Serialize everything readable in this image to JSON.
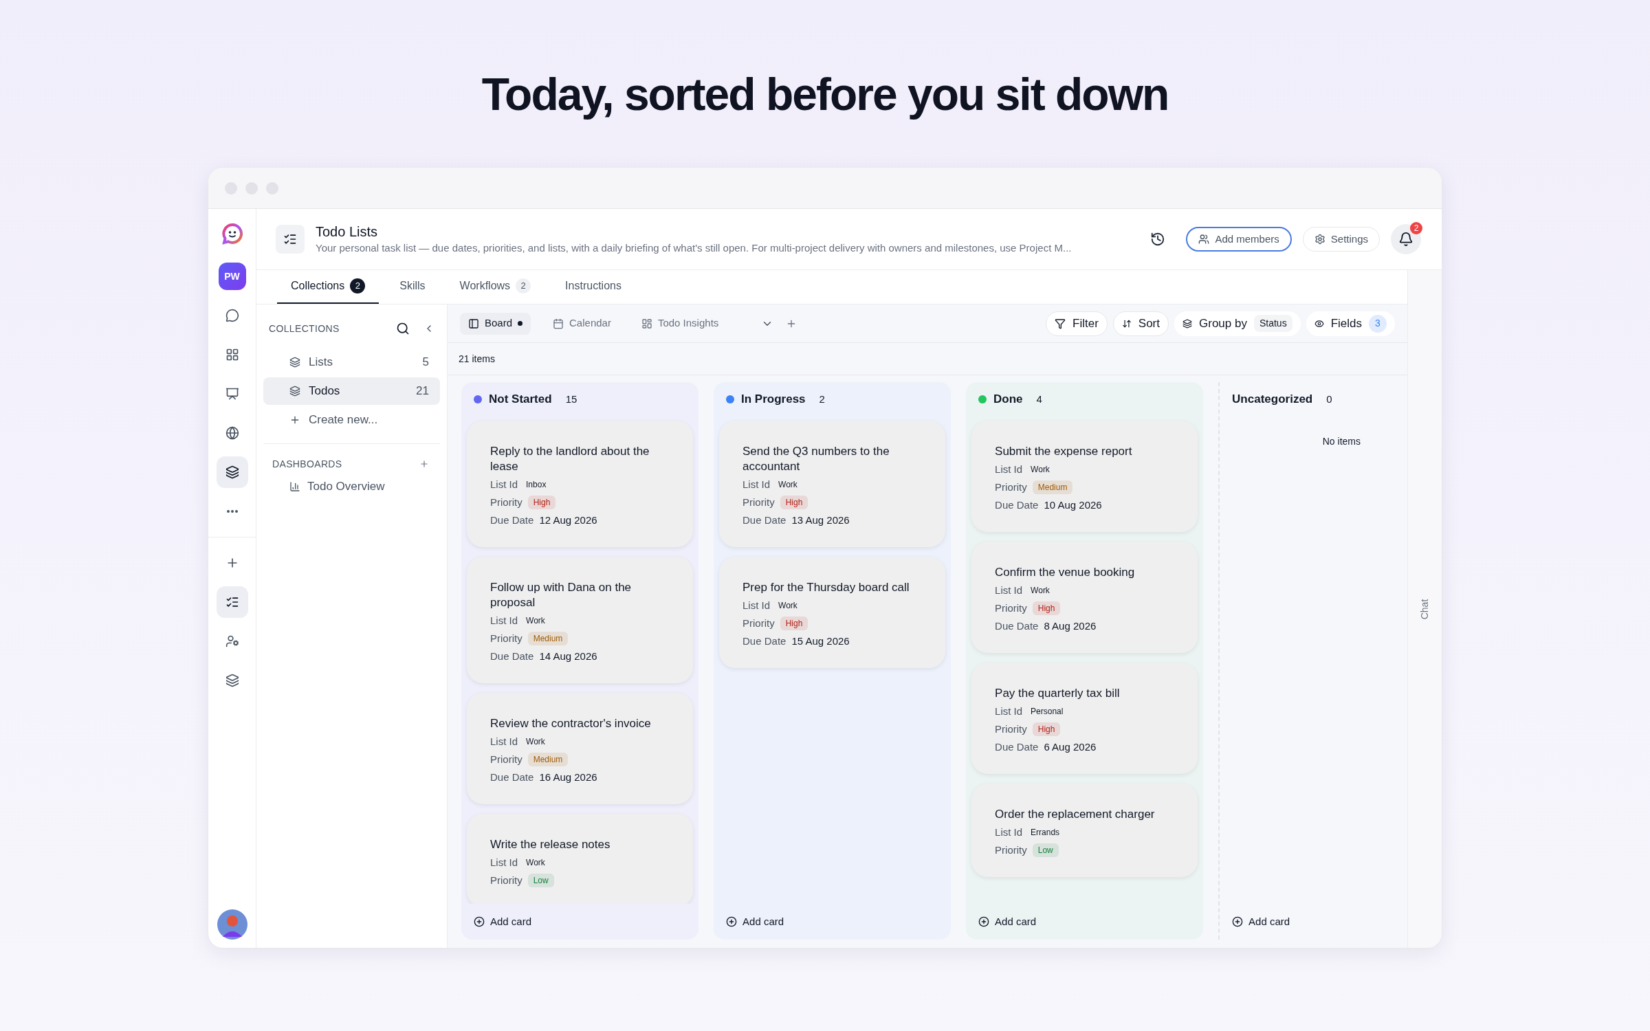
{
  "headline": "Today, sorted before you sit down",
  "rail": {
    "avatar": "PW",
    "items": [
      {
        "kind": "chat",
        "selected": false
      },
      {
        "kind": "grid",
        "selected": false
      },
      {
        "kind": "app",
        "selected": false
      },
      {
        "kind": "globe",
        "selected": false
      },
      {
        "kind": "layers",
        "selected": true
      },
      {
        "kind": "more",
        "selected": false
      }
    ],
    "apps": [
      {
        "kind": "plus",
        "selected": false
      },
      {
        "kind": "todo",
        "selected": true
      },
      {
        "kind": "person",
        "selected": false
      },
      {
        "kind": "layers",
        "selected": false
      }
    ]
  },
  "header": {
    "title": "Todo Lists",
    "description": "Your personal task list — due dates, priorities, and lists, with a daily briefing of what's still open. For multi-project delivery with owners and milestones, use Project M...",
    "add_members": "Add members",
    "settings": "Settings",
    "notifications": "2"
  },
  "tabs": [
    {
      "label": "Collections",
      "count": "2",
      "selected": true
    },
    {
      "label": "Skills",
      "selected": false
    },
    {
      "label": "Workflows",
      "count": "2",
      "selected": false
    },
    {
      "label": "Instructions",
      "selected": false
    }
  ],
  "sidebar": {
    "collections_heading": "COLLECTIONS",
    "collections": [
      {
        "label": "Lists",
        "count": "5",
        "selected": false
      },
      {
        "label": "Todos",
        "count": "21",
        "selected": true
      }
    ],
    "create_new": "Create new...",
    "dashboards_heading": "DASHBOARDS",
    "dashboards": [
      {
        "label": "Todo Overview"
      }
    ]
  },
  "views": [
    {
      "label": "Board",
      "kind": "board",
      "selected": true
    },
    {
      "label": "Calendar",
      "kind": "calendar",
      "selected": false
    },
    {
      "label": "Todo Insights",
      "kind": "insights",
      "selected": false
    }
  ],
  "toolbar": {
    "filter": "Filter",
    "sort": "Sort",
    "group_by": "Group by",
    "group_value": "Status",
    "fields": "Fields",
    "fields_count": "3"
  },
  "item_count": "21 items",
  "columns": [
    {
      "title": "Not Started",
      "count": "15",
      "color": "#6366f1",
      "add": "Add card",
      "cards": [
        {
          "title": "Reply to the landlord about the lease",
          "fields": [
            {
              "label": "List Id",
              "value": "Inbox",
              "kind": "tag"
            },
            {
              "label": "Priority",
              "value": "High",
              "kind": "priority",
              "color": "#b42318"
            },
            {
              "label": "Due Date",
              "value": "12 Aug 2026",
              "kind": "text"
            }
          ]
        },
        {
          "title": "Follow up with Dana on the proposal",
          "fields": [
            {
              "label": "List Id",
              "value": "Work",
              "kind": "tag"
            },
            {
              "label": "Priority",
              "value": "Medium",
              "kind": "priority",
              "color": "#a15c07"
            },
            {
              "label": "Due Date",
              "value": "14 Aug 2026",
              "kind": "text"
            }
          ]
        },
        {
          "title": "Review the contractor's invoice",
          "fields": [
            {
              "label": "List Id",
              "value": "Work",
              "kind": "tag"
            },
            {
              "label": "Priority",
              "value": "Medium",
              "kind": "priority",
              "color": "#a15c07"
            },
            {
              "label": "Due Date",
              "value": "16 Aug 2026",
              "kind": "text"
            }
          ]
        },
        {
          "title": "Write the release notes",
          "fields": [
            {
              "label": "List Id",
              "value": "Work",
              "kind": "tag"
            },
            {
              "label": "Priority",
              "value": "Low",
              "kind": "priority",
              "color": "#15803d"
            }
          ]
        }
      ]
    },
    {
      "title": "In Progress",
      "count": "2",
      "color": "#3b82f6",
      "add": "Add card",
      "cards": [
        {
          "title": "Send the Q3 numbers to the accountant",
          "fields": [
            {
              "label": "List Id",
              "value": "Work",
              "kind": "tag"
            },
            {
              "label": "Priority",
              "value": "High",
              "kind": "priority",
              "color": "#b42318"
            },
            {
              "label": "Due Date",
              "value": "13 Aug 2026",
              "kind": "text"
            }
          ]
        },
        {
          "title": "Prep for the Thursday board call",
          "fields": [
            {
              "label": "List Id",
              "value": "Work",
              "kind": "tag"
            },
            {
              "label": "Priority",
              "value": "High",
              "kind": "priority",
              "color": "#b42318"
            },
            {
              "label": "Due Date",
              "value": "15 Aug 2026",
              "kind": "text"
            }
          ]
        }
      ]
    },
    {
      "title": "Done",
      "count": "4",
      "color": "#22c55e",
      "add": "Add card",
      "cards": [
        {
          "title": "Submit the expense report",
          "fields": [
            {
              "label": "List Id",
              "value": "Work",
              "kind": "tag"
            },
            {
              "label": "Priority",
              "value": "Medium",
              "kind": "priority",
              "color": "#a15c07"
            },
            {
              "label": "Due Date",
              "value": "10 Aug 2026",
              "kind": "text"
            }
          ]
        },
        {
          "title": "Confirm the venue booking",
          "fields": [
            {
              "label": "List Id",
              "value": "Work",
              "kind": "tag"
            },
            {
              "label": "Priority",
              "value": "High",
              "kind": "priority",
              "color": "#b42318"
            },
            {
              "label": "Due Date",
              "value": "8 Aug 2026",
              "kind": "text"
            }
          ]
        },
        {
          "title": "Pay the quarterly tax bill",
          "fields": [
            {
              "label": "List Id",
              "value": "Personal",
              "kind": "tag"
            },
            {
              "label": "Priority",
              "value": "High",
              "kind": "priority",
              "color": "#b42318"
            },
            {
              "label": "Due Date",
              "value": "6 Aug 2026",
              "kind": "text"
            }
          ]
        },
        {
          "title": "Order the replacement charger",
          "fields": [
            {
              "label": "List Id",
              "value": "Errands",
              "kind": "tag"
            },
            {
              "label": "Priority",
              "value": "Low",
              "kind": "priority",
              "color": "#15803d"
            }
          ]
        }
      ]
    },
    {
      "title": "Uncategorized",
      "count": "0",
      "empty": "No items",
      "add": "Add card"
    }
  ],
  "chat_label": "Chat"
}
